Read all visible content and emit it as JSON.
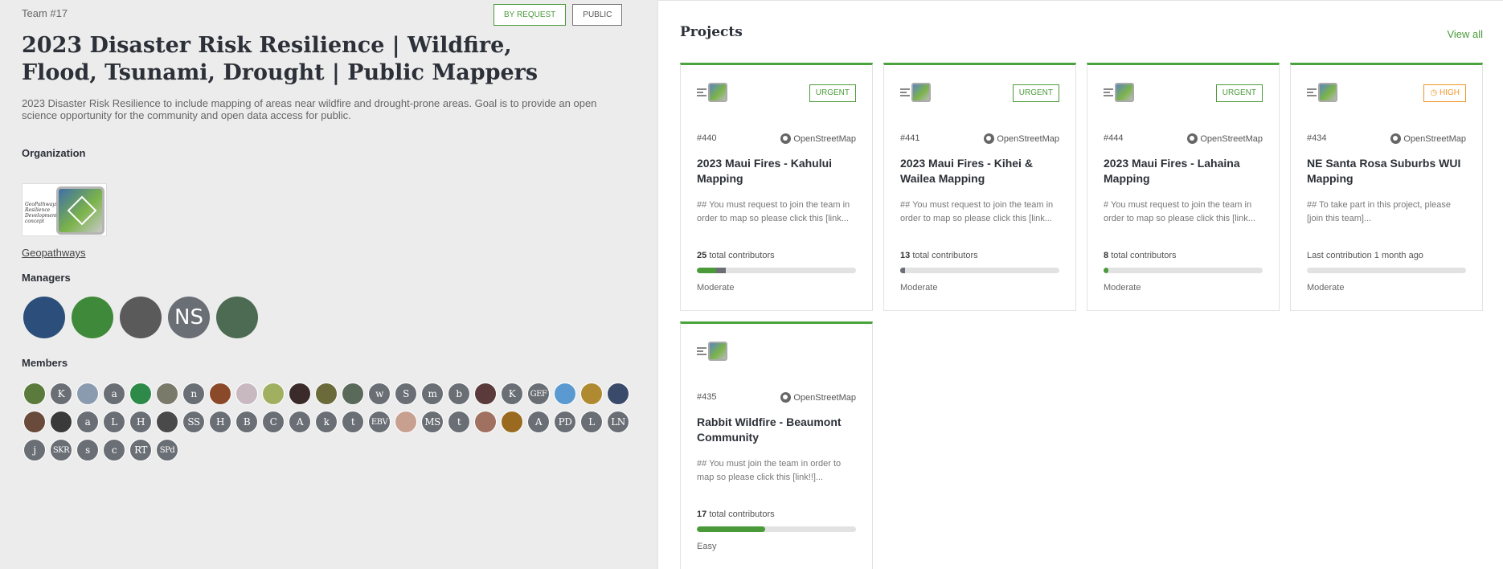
{
  "team": {
    "id_label": "Team #17",
    "tags": [
      "BY REQUEST",
      "PUBLIC"
    ],
    "title": "2023 Disaster Risk Resilience | Wildfire, Flood, Tsunami, Drought | Public Mappers",
    "description": "2023 Disaster Risk Resilience to include mapping of areas near wildfire and drought-prone areas. Goal is to provide an open science opportunity for the community and open data access for public.",
    "organization_heading": "Organization",
    "organization_logo_text": "GeoPathways Resilience Development concept",
    "organization_name": "Geopathways",
    "managers_heading": "Managers",
    "managers": [
      {
        "initials": "",
        "color": "#2b4f7a"
      },
      {
        "initials": "",
        "color": "#3f8a3a"
      },
      {
        "initials": "",
        "color": "#5a5a5a"
      },
      {
        "initials": "NS",
        "color": "#6a6e75"
      },
      {
        "initials": "",
        "color": "#4d6a52"
      }
    ],
    "members_heading": "Members",
    "members": [
      {
        "t": "",
        "c": "#5a7b3b"
      },
      {
        "t": "K",
        "c": "#6a6e75"
      },
      {
        "t": "",
        "c": "#8a9bb0"
      },
      {
        "t": "a",
        "c": "#6a6e75"
      },
      {
        "t": "",
        "c": "#2e8a48"
      },
      {
        "t": "",
        "c": "#7a7a6a"
      },
      {
        "t": "n",
        "c": "#6a6e75"
      },
      {
        "t": "",
        "c": "#8a4a2a"
      },
      {
        "t": "",
        "c": "#c8b8c0"
      },
      {
        "t": "",
        "c": "#a0b060"
      },
      {
        "t": "",
        "c": "#3a2a2a"
      },
      {
        "t": "",
        "c": "#6a6a3a"
      },
      {
        "t": "",
        "c": "#5a6a5a"
      },
      {
        "t": "w",
        "c": "#6a6e75"
      },
      {
        "t": "S",
        "c": "#6a6e75"
      },
      {
        "t": "m",
        "c": "#6a6e75"
      },
      {
        "t": "b",
        "c": "#6a6e75"
      },
      {
        "t": "",
        "c": "#5a3a3a"
      },
      {
        "t": "K",
        "c": "#6a6e75"
      },
      {
        "t": "GEF",
        "c": "#6a6e75"
      },
      {
        "t": "",
        "c": "#5a9ad0"
      },
      {
        "t": "",
        "c": "#b08a30"
      },
      {
        "t": "",
        "c": "#3a4a6a"
      },
      {
        "t": "",
        "c": "#6a4a3a"
      },
      {
        "t": "",
        "c": "#3a3a3a"
      },
      {
        "t": "a",
        "c": "#6a6e75"
      },
      {
        "t": "L",
        "c": "#6a6e75"
      },
      {
        "t": "H",
        "c": "#6a6e75"
      },
      {
        "t": "",
        "c": "#4a4a4a"
      },
      {
        "t": "SS",
        "c": "#6a6e75"
      },
      {
        "t": "H",
        "c": "#6a6e75"
      },
      {
        "t": "B",
        "c": "#6a6e75"
      },
      {
        "t": "C",
        "c": "#6a6e75"
      },
      {
        "t": "A",
        "c": "#6a6e75"
      },
      {
        "t": "k",
        "c": "#6a6e75"
      },
      {
        "t": "t",
        "c": "#6a6e75"
      },
      {
        "t": "EBV",
        "c": "#6a6e75"
      },
      {
        "t": "",
        "c": "#c8a090"
      },
      {
        "t": "MS",
        "c": "#6a6e75"
      },
      {
        "t": "t",
        "c": "#6a6e75"
      },
      {
        "t": "",
        "c": "#a07060"
      },
      {
        "t": "",
        "c": "#9a6a20"
      },
      {
        "t": "A",
        "c": "#6a6e75"
      },
      {
        "t": "PD",
        "c": "#6a6e75"
      },
      {
        "t": "L",
        "c": "#6a6e75"
      },
      {
        "t": "LN",
        "c": "#6a6e75"
      },
      {
        "t": "j",
        "c": "#6a6e75"
      },
      {
        "t": "SKR",
        "c": "#6a6e75"
      },
      {
        "t": "s",
        "c": "#6a6e75"
      },
      {
        "t": "c",
        "c": "#6a6e75"
      },
      {
        "t": "RT",
        "c": "#6a6e75"
      },
      {
        "t": "SPd",
        "c": "#6a6e75"
      }
    ]
  },
  "projects": {
    "heading": "Projects",
    "view_all": "View all",
    "osm_label": "OpenStreetMap",
    "cards": [
      {
        "priority": "URGENT",
        "priority_kind": "urgent",
        "number": "#440",
        "title": "2023 Maui Fires - Kahului Mapping",
        "desc": "## You must request to join the team in order to map so please click this [link...",
        "contrib_count": "25",
        "contrib_text": "total contributors",
        "mapped": 0.18,
        "validated": 0.06,
        "difficulty": "Moderate"
      },
      {
        "priority": "URGENT",
        "priority_kind": "urgent",
        "number": "#441",
        "title": "2023 Maui Fires - Kihei & Wailea Mapping",
        "desc": "## You must request to join the team in order to map so please click this [link...",
        "contrib_count": "13",
        "contrib_text": "total contributors",
        "mapped": 0.03,
        "validated": 0.03,
        "difficulty": "Moderate"
      },
      {
        "priority": "URGENT",
        "priority_kind": "urgent",
        "number": "#444",
        "title": "2023 Maui Fires - Lahaina Mapping",
        "desc": "# You must request to join the team in order to map so please click this [link...",
        "contrib_count": "8",
        "contrib_text": "total contributors",
        "mapped": 0.03,
        "validated": 0,
        "difficulty": "Moderate"
      },
      {
        "priority": "HIGH",
        "priority_kind": "high",
        "number": "#434",
        "title": "NE Santa Rosa Suburbs WUI Mapping",
        "desc": "## To take part in this project, please [join this team]...",
        "contrib_count": "",
        "contrib_text": "Last contribution 1 month ago",
        "mapped": 0,
        "validated": 0,
        "difficulty": "Moderate"
      },
      {
        "priority": "",
        "priority_kind": "",
        "number": "#435",
        "title": "Rabbit Wildfire - Beaumont Community",
        "desc": "## You must join the team in order to map so please click this [link!!]...",
        "contrib_count": "17",
        "contrib_text": "total contributors",
        "mapped": 0.43,
        "validated": 0,
        "difficulty": "Easy"
      }
    ]
  }
}
